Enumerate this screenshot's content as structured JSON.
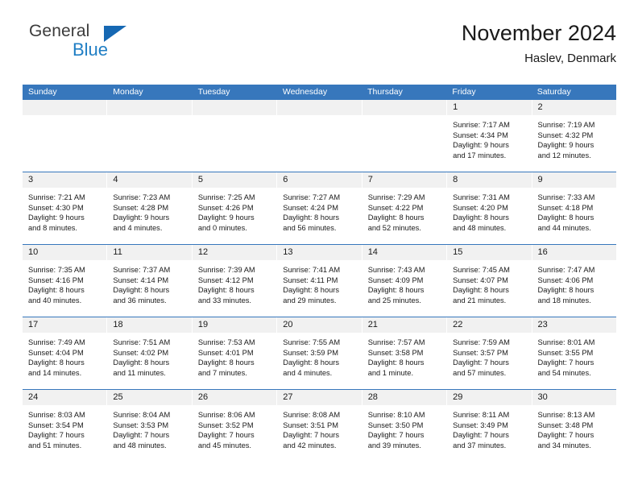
{
  "brand": {
    "name_part1": "General",
    "name_part2": "Blue",
    "triangle_icon": "triangle-icon",
    "color_primary": "#1668b3",
    "color_secondary": "#1f7ec4"
  },
  "header": {
    "title": "November 2024",
    "subtitle": "Haslev, Denmark",
    "header_bg": "#3777bc"
  },
  "weekdays": [
    "Sunday",
    "Monday",
    "Tuesday",
    "Wednesday",
    "Thursday",
    "Friday",
    "Saturday"
  ],
  "weeks": [
    [
      {
        "day": "",
        "empty": true,
        "sunrise": "",
        "sunset": "",
        "daylight1": "",
        "daylight2": ""
      },
      {
        "day": "",
        "empty": true,
        "sunrise": "",
        "sunset": "",
        "daylight1": "",
        "daylight2": ""
      },
      {
        "day": "",
        "empty": true,
        "sunrise": "",
        "sunset": "",
        "daylight1": "",
        "daylight2": ""
      },
      {
        "day": "",
        "empty": true,
        "sunrise": "",
        "sunset": "",
        "daylight1": "",
        "daylight2": ""
      },
      {
        "day": "",
        "empty": true,
        "sunrise": "",
        "sunset": "",
        "daylight1": "",
        "daylight2": ""
      },
      {
        "day": "1",
        "empty": false,
        "sunrise": "Sunrise: 7:17 AM",
        "sunset": "Sunset: 4:34 PM",
        "daylight1": "Daylight: 9 hours",
        "daylight2": "and 17 minutes."
      },
      {
        "day": "2",
        "empty": false,
        "sunrise": "Sunrise: 7:19 AM",
        "sunset": "Sunset: 4:32 PM",
        "daylight1": "Daylight: 9 hours",
        "daylight2": "and 12 minutes."
      }
    ],
    [
      {
        "day": "3",
        "empty": false,
        "sunrise": "Sunrise: 7:21 AM",
        "sunset": "Sunset: 4:30 PM",
        "daylight1": "Daylight: 9 hours",
        "daylight2": "and 8 minutes."
      },
      {
        "day": "4",
        "empty": false,
        "sunrise": "Sunrise: 7:23 AM",
        "sunset": "Sunset: 4:28 PM",
        "daylight1": "Daylight: 9 hours",
        "daylight2": "and 4 minutes."
      },
      {
        "day": "5",
        "empty": false,
        "sunrise": "Sunrise: 7:25 AM",
        "sunset": "Sunset: 4:26 PM",
        "daylight1": "Daylight: 9 hours",
        "daylight2": "and 0 minutes."
      },
      {
        "day": "6",
        "empty": false,
        "sunrise": "Sunrise: 7:27 AM",
        "sunset": "Sunset: 4:24 PM",
        "daylight1": "Daylight: 8 hours",
        "daylight2": "and 56 minutes."
      },
      {
        "day": "7",
        "empty": false,
        "sunrise": "Sunrise: 7:29 AM",
        "sunset": "Sunset: 4:22 PM",
        "daylight1": "Daylight: 8 hours",
        "daylight2": "and 52 minutes."
      },
      {
        "day": "8",
        "empty": false,
        "sunrise": "Sunrise: 7:31 AM",
        "sunset": "Sunset: 4:20 PM",
        "daylight1": "Daylight: 8 hours",
        "daylight2": "and 48 minutes."
      },
      {
        "day": "9",
        "empty": false,
        "sunrise": "Sunrise: 7:33 AM",
        "sunset": "Sunset: 4:18 PM",
        "daylight1": "Daylight: 8 hours",
        "daylight2": "and 44 minutes."
      }
    ],
    [
      {
        "day": "10",
        "empty": false,
        "sunrise": "Sunrise: 7:35 AM",
        "sunset": "Sunset: 4:16 PM",
        "daylight1": "Daylight: 8 hours",
        "daylight2": "and 40 minutes."
      },
      {
        "day": "11",
        "empty": false,
        "sunrise": "Sunrise: 7:37 AM",
        "sunset": "Sunset: 4:14 PM",
        "daylight1": "Daylight: 8 hours",
        "daylight2": "and 36 minutes."
      },
      {
        "day": "12",
        "empty": false,
        "sunrise": "Sunrise: 7:39 AM",
        "sunset": "Sunset: 4:12 PM",
        "daylight1": "Daylight: 8 hours",
        "daylight2": "and 33 minutes."
      },
      {
        "day": "13",
        "empty": false,
        "sunrise": "Sunrise: 7:41 AM",
        "sunset": "Sunset: 4:11 PM",
        "daylight1": "Daylight: 8 hours",
        "daylight2": "and 29 minutes."
      },
      {
        "day": "14",
        "empty": false,
        "sunrise": "Sunrise: 7:43 AM",
        "sunset": "Sunset: 4:09 PM",
        "daylight1": "Daylight: 8 hours",
        "daylight2": "and 25 minutes."
      },
      {
        "day": "15",
        "empty": false,
        "sunrise": "Sunrise: 7:45 AM",
        "sunset": "Sunset: 4:07 PM",
        "daylight1": "Daylight: 8 hours",
        "daylight2": "and 21 minutes."
      },
      {
        "day": "16",
        "empty": false,
        "sunrise": "Sunrise: 7:47 AM",
        "sunset": "Sunset: 4:06 PM",
        "daylight1": "Daylight: 8 hours",
        "daylight2": "and 18 minutes."
      }
    ],
    [
      {
        "day": "17",
        "empty": false,
        "sunrise": "Sunrise: 7:49 AM",
        "sunset": "Sunset: 4:04 PM",
        "daylight1": "Daylight: 8 hours",
        "daylight2": "and 14 minutes."
      },
      {
        "day": "18",
        "empty": false,
        "sunrise": "Sunrise: 7:51 AM",
        "sunset": "Sunset: 4:02 PM",
        "daylight1": "Daylight: 8 hours",
        "daylight2": "and 11 minutes."
      },
      {
        "day": "19",
        "empty": false,
        "sunrise": "Sunrise: 7:53 AM",
        "sunset": "Sunset: 4:01 PM",
        "daylight1": "Daylight: 8 hours",
        "daylight2": "and 7 minutes."
      },
      {
        "day": "20",
        "empty": false,
        "sunrise": "Sunrise: 7:55 AM",
        "sunset": "Sunset: 3:59 PM",
        "daylight1": "Daylight: 8 hours",
        "daylight2": "and 4 minutes."
      },
      {
        "day": "21",
        "empty": false,
        "sunrise": "Sunrise: 7:57 AM",
        "sunset": "Sunset: 3:58 PM",
        "daylight1": "Daylight: 8 hours",
        "daylight2": "and 1 minute."
      },
      {
        "day": "22",
        "empty": false,
        "sunrise": "Sunrise: 7:59 AM",
        "sunset": "Sunset: 3:57 PM",
        "daylight1": "Daylight: 7 hours",
        "daylight2": "and 57 minutes."
      },
      {
        "day": "23",
        "empty": false,
        "sunrise": "Sunrise: 8:01 AM",
        "sunset": "Sunset: 3:55 PM",
        "daylight1": "Daylight: 7 hours",
        "daylight2": "and 54 minutes."
      }
    ],
    [
      {
        "day": "24",
        "empty": false,
        "sunrise": "Sunrise: 8:03 AM",
        "sunset": "Sunset: 3:54 PM",
        "daylight1": "Daylight: 7 hours",
        "daylight2": "and 51 minutes."
      },
      {
        "day": "25",
        "empty": false,
        "sunrise": "Sunrise: 8:04 AM",
        "sunset": "Sunset: 3:53 PM",
        "daylight1": "Daylight: 7 hours",
        "daylight2": "and 48 minutes."
      },
      {
        "day": "26",
        "empty": false,
        "sunrise": "Sunrise: 8:06 AM",
        "sunset": "Sunset: 3:52 PM",
        "daylight1": "Daylight: 7 hours",
        "daylight2": "and 45 minutes."
      },
      {
        "day": "27",
        "empty": false,
        "sunrise": "Sunrise: 8:08 AM",
        "sunset": "Sunset: 3:51 PM",
        "daylight1": "Daylight: 7 hours",
        "daylight2": "and 42 minutes."
      },
      {
        "day": "28",
        "empty": false,
        "sunrise": "Sunrise: 8:10 AM",
        "sunset": "Sunset: 3:50 PM",
        "daylight1": "Daylight: 7 hours",
        "daylight2": "and 39 minutes."
      },
      {
        "day": "29",
        "empty": false,
        "sunrise": "Sunrise: 8:11 AM",
        "sunset": "Sunset: 3:49 PM",
        "daylight1": "Daylight: 7 hours",
        "daylight2": "and 37 minutes."
      },
      {
        "day": "30",
        "empty": false,
        "sunrise": "Sunrise: 8:13 AM",
        "sunset": "Sunset: 3:48 PM",
        "daylight1": "Daylight: 7 hours",
        "daylight2": "and 34 minutes."
      }
    ]
  ]
}
